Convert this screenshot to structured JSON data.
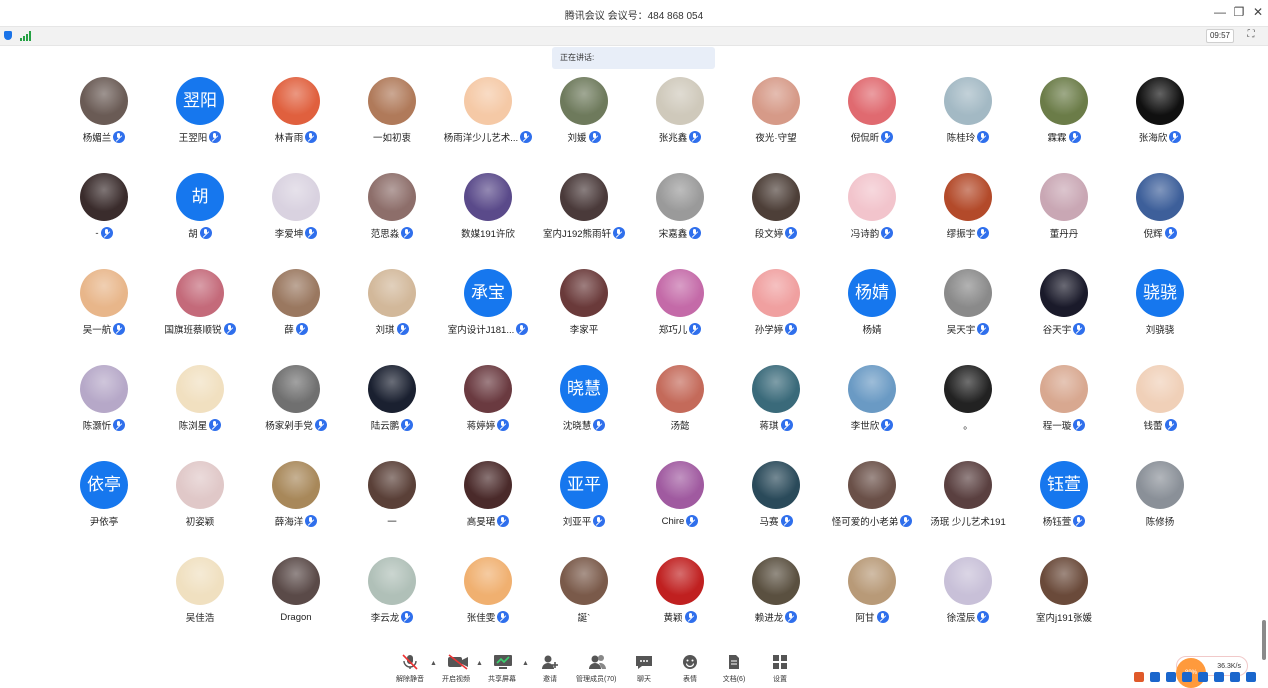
{
  "window": {
    "title": "腾讯会议 会议号：484 868 054",
    "minimize_glyph": "—",
    "restore_glyph": "❐",
    "close_glyph": "✕"
  },
  "status": {
    "time": "09:57",
    "fullscreen_glyph": "⛶"
  },
  "speaking_label": "正在讲话:",
  "colors": {
    "accent": "#1677ee",
    "mic": "#2f6fec",
    "signal": "#25a244"
  },
  "participants": [
    {
      "name": "杨媚兰",
      "mic": true,
      "avatar": "photo",
      "color": "#6a5b55"
    },
    {
      "name": "王翌阳",
      "mic": true,
      "avatar": "initials",
      "initials": "翌阳"
    },
    {
      "name": "林青雨",
      "mic": true,
      "avatar": "photo",
      "color": "#e0603e"
    },
    {
      "name": "一如初衷",
      "mic": false,
      "avatar": "photo",
      "color": "#b07a5a"
    },
    {
      "name": "杨雨洋少儿艺术...",
      "mic": true,
      "avatar": "photo",
      "color": "#f5c9a6"
    },
    {
      "name": "刘媛",
      "mic": true,
      "avatar": "photo",
      "color": "#6e7a5c"
    },
    {
      "name": "张兆鑫",
      "mic": true,
      "avatar": "photo",
      "color": "#cfc9bb"
    },
    {
      "name": "夜光·守望",
      "mic": false,
      "avatar": "photo",
      "color": "#d69a88"
    },
    {
      "name": "倪侃昕",
      "mic": true,
      "avatar": "photo",
      "color": "#e06a70"
    },
    {
      "name": "陈桂玲",
      "mic": true,
      "avatar": "photo",
      "color": "#a3b9c4"
    },
    {
      "name": "霖霖",
      "mic": true,
      "avatar": "photo",
      "color": "#6b7c48"
    },
    {
      "name": "张海欣",
      "mic": true,
      "avatar": "photo",
      "color": "#101010"
    },
    {
      "name": "-",
      "mic": true,
      "avatar": "photo",
      "color": "#3a2c2c"
    },
    {
      "name": "胡",
      "mic": true,
      "avatar": "initials",
      "initials": "胡"
    },
    {
      "name": "李爱坤",
      "mic": true,
      "avatar": "photo",
      "color": "#d9d2e0"
    },
    {
      "name": "范思淼",
      "mic": true,
      "avatar": "photo",
      "color": "#8d6e6a"
    },
    {
      "name": "数媒191许欣",
      "mic": false,
      "avatar": "photo",
      "color": "#5a4a8a"
    },
    {
      "name": "室内J192熊雨轩",
      "mic": true,
      "avatar": "photo",
      "color": "#4a3a3a"
    },
    {
      "name": "宋嘉鑫",
      "mic": true,
      "avatar": "photo",
      "color": "#9a9a9a"
    },
    {
      "name": "段文婷",
      "mic": true,
      "avatar": "photo",
      "color": "#4d3f38"
    },
    {
      "name": "冯诗韵",
      "mic": true,
      "avatar": "photo",
      "color": "#f2c4cc"
    },
    {
      "name": "缪振宇",
      "mic": true,
      "avatar": "photo",
      "color": "#b34a2a"
    },
    {
      "name": "董丹丹",
      "mic": false,
      "avatar": "photo",
      "color": "#c9a7b4"
    },
    {
      "name": "倪辉",
      "mic": true,
      "avatar": "photo",
      "color": "#3d5f9a"
    },
    {
      "name": "吴一航",
      "mic": true,
      "avatar": "photo",
      "color": "#e8b68a"
    },
    {
      "name": "国旗班蔡顺锐",
      "mic": true,
      "avatar": "photo",
      "color": "#c46a7a"
    },
    {
      "name": "薛",
      "mic": true,
      "avatar": "photo",
      "color": "#9a7860"
    },
    {
      "name": "刘琪",
      "mic": true,
      "avatar": "photo",
      "color": "#d2b89a"
    },
    {
      "name": "室内设计J181...",
      "mic": true,
      "avatar": "initials",
      "initials": "承宝"
    },
    {
      "name": "李家平",
      "mic": false,
      "avatar": "photo",
      "color": "#6a3a3a"
    },
    {
      "name": "郑巧儿",
      "mic": true,
      "avatar": "photo",
      "color": "#c46aa8"
    },
    {
      "name": "孙学婷",
      "mic": true,
      "avatar": "photo",
      "color": "#f0a0a0"
    },
    {
      "name": "杨婧",
      "mic": false,
      "avatar": "initials",
      "initials": "杨婧"
    },
    {
      "name": "吴天宇",
      "mic": true,
      "avatar": "photo",
      "color": "#8a8a8a"
    },
    {
      "name": "谷天宇",
      "mic": true,
      "avatar": "photo",
      "color": "#1a1a2a"
    },
    {
      "name": "刘骁骁",
      "mic": false,
      "avatar": "initials",
      "initials": "骁骁"
    },
    {
      "name": "陈灏忻",
      "mic": true,
      "avatar": "photo",
      "color": "#b6a8c8"
    },
    {
      "name": "陈浏星",
      "mic": true,
      "avatar": "photo",
      "color": "#f1e0c0"
    },
    {
      "name": "杨家剁手党",
      "mic": true,
      "avatar": "photo",
      "color": "#707070"
    },
    {
      "name": "陆云鹏",
      "mic": true,
      "avatar": "photo",
      "color": "#1a2030"
    },
    {
      "name": "蒋婷婷",
      "mic": true,
      "avatar": "photo",
      "color": "#6a3a40"
    },
    {
      "name": "沈晓慧",
      "mic": true,
      "avatar": "initials",
      "initials": "晓慧"
    },
    {
      "name": "汤懿",
      "mic": false,
      "avatar": "photo",
      "color": "#c46a5a"
    },
    {
      "name": "蒋琪",
      "mic": true,
      "avatar": "photo",
      "color": "#3a6a7a"
    },
    {
      "name": "李世欣",
      "mic": true,
      "avatar": "photo",
      "color": "#6a9ac4"
    },
    {
      "name": "。",
      "mic": false,
      "avatar": "photo",
      "color": "#222222"
    },
    {
      "name": "程一璇",
      "mic": true,
      "avatar": "photo",
      "color": "#d8a890"
    },
    {
      "name": "钱蕾",
      "mic": true,
      "avatar": "photo",
      "color": "#f0d0b8"
    },
    {
      "name": "尹依亭",
      "mic": false,
      "avatar": "initials",
      "initials": "依亭"
    },
    {
      "name": "初姿颖",
      "mic": false,
      "avatar": "photo",
      "color": "#e0c8c8"
    },
    {
      "name": "薛海洋",
      "mic": true,
      "avatar": "photo",
      "color": "#a8885a"
    },
    {
      "name": "一",
      "mic": false,
      "avatar": "photo",
      "color": "#5a4038"
    },
    {
      "name": "高旻珺",
      "mic": true,
      "avatar": "photo",
      "color": "#4a2a2a"
    },
    {
      "name": "刘亚平",
      "mic": true,
      "avatar": "initials",
      "initials": "亚平"
    },
    {
      "name": "Chire",
      "mic": true,
      "avatar": "photo",
      "color": "#a05aa0"
    },
    {
      "name": "马赛",
      "mic": true,
      "avatar": "photo",
      "color": "#2a4a5a"
    },
    {
      "name": "怪可爱的小老弟",
      "mic": true,
      "avatar": "photo",
      "color": "#6a5048"
    },
    {
      "name": "汤珉 少儿艺术191",
      "mic": false,
      "avatar": "photo",
      "color": "#5a4040"
    },
    {
      "name": "杨钰萱",
      "mic": true,
      "avatar": "initials",
      "initials": "钰萱"
    },
    {
      "name": "陈修扬",
      "mic": false,
      "avatar": "photo",
      "color": "#8a9098"
    },
    {
      "name": "吴佳浩",
      "mic": false,
      "avatar": "photo",
      "color": "#f0e0c0"
    },
    {
      "name": "Dragon",
      "mic": false,
      "avatar": "photo",
      "color": "#5a4a48"
    },
    {
      "name": "李云龙",
      "mic": true,
      "avatar": "photo",
      "color": "#b0c0b8"
    },
    {
      "name": "张佳雯",
      "mic": true,
      "avatar": "photo",
      "color": "#f0b070"
    },
    {
      "name": "誕`",
      "mic": false,
      "avatar": "photo",
      "color": "#7a5a4a"
    },
    {
      "name": "黄颖",
      "mic": true,
      "avatar": "photo",
      "color": "#c02020"
    },
    {
      "name": "赖进龙",
      "mic": true,
      "avatar": "photo",
      "color": "#5a5040"
    },
    {
      "name": "阿甘",
      "mic": true,
      "avatar": "photo",
      "color": "#b89a78"
    },
    {
      "name": "徐滢辰",
      "mic": true,
      "avatar": "photo",
      "color": "#c8c0d8"
    },
    {
      "name": "室内j191张媛",
      "mic": false,
      "avatar": "photo",
      "color": "#6a4a3a"
    }
  ],
  "toolbar": [
    {
      "id": "mute",
      "label": "解除静音",
      "icon": "mic-off-icon",
      "caret": true
    },
    {
      "id": "video",
      "label": "开启视频",
      "icon": "video-off-icon",
      "caret": true
    },
    {
      "id": "share",
      "label": "共享屏幕",
      "icon": "share-screen-icon",
      "caret": true
    },
    {
      "id": "invite",
      "label": "邀请",
      "icon": "invite-icon",
      "caret": false
    },
    {
      "id": "members",
      "label": "管理成员(70)",
      "icon": "members-icon",
      "caret": false
    },
    {
      "id": "chat",
      "label": "聊天",
      "icon": "chat-icon",
      "caret": false
    },
    {
      "id": "emoji",
      "label": "表情",
      "icon": "emoji-icon",
      "caret": false
    },
    {
      "id": "docs",
      "label": "文档(6)",
      "icon": "document-icon",
      "caret": false
    },
    {
      "id": "settings",
      "label": "设置",
      "icon": "settings-icon",
      "caret": false
    }
  ],
  "network": {
    "speed": "36.3K/s",
    "percent": "89%"
  }
}
